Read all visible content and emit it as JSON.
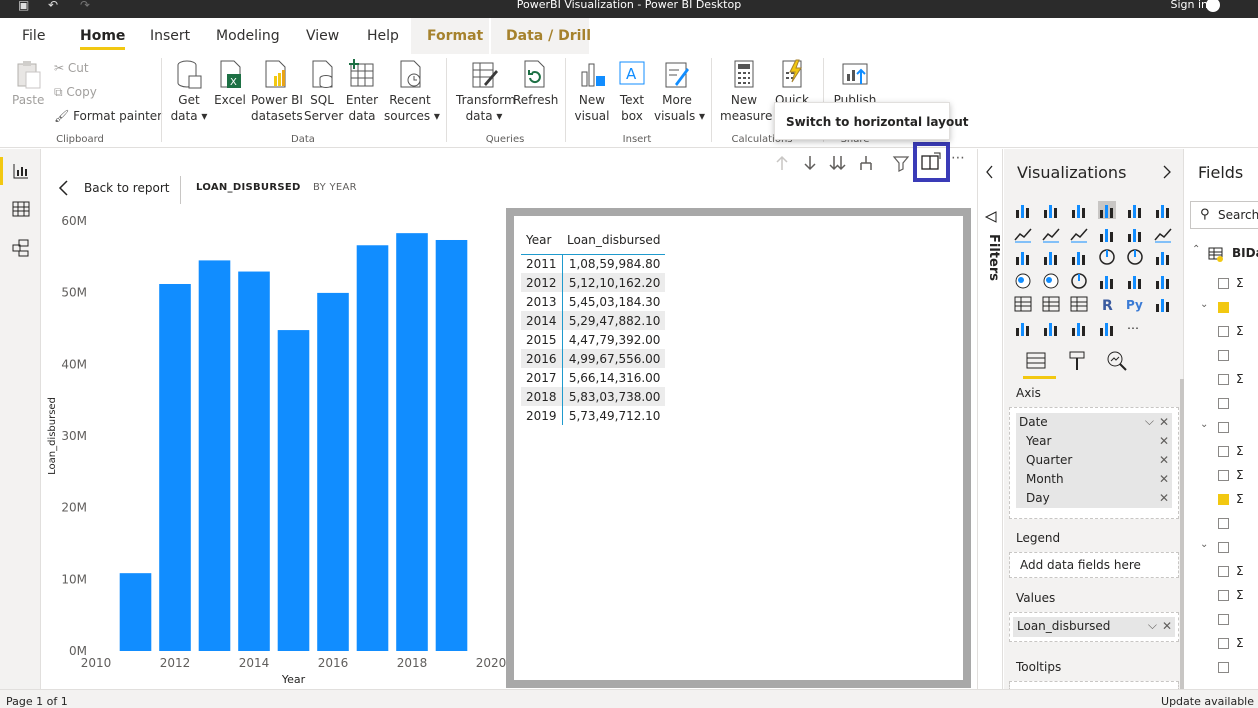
{
  "app": {
    "title": "PowerBI Visualization - Power BI Desktop",
    "signin": "Sign in"
  },
  "tabs": [
    "File",
    "Home",
    "Insert",
    "Modeling",
    "View",
    "Help",
    "Format",
    "Data / Drill"
  ],
  "ribbon": {
    "paste": "Paste",
    "cut": "Cut",
    "copy": "Copy",
    "format_painter": "Format painter",
    "get_data": [
      "Get",
      "data ▾"
    ],
    "excel": "Excel",
    "pbi_datasets": [
      "Power BI",
      "datasets"
    ],
    "sql": [
      "SQL",
      "Server"
    ],
    "enter_data": [
      "Enter",
      "data"
    ],
    "recent": [
      "Recent",
      "sources ▾"
    ],
    "transform": [
      "Transform",
      "data ▾"
    ],
    "refresh": "Refresh",
    "new_visual": [
      "New",
      "visual"
    ],
    "text_box": [
      "Text",
      "box"
    ],
    "more_visuals": [
      "More",
      "visuals ▾"
    ],
    "new_measure": [
      "New",
      "measure"
    ],
    "quick_measure": [
      "Quick",
      "m"
    ],
    "publish": "Publish",
    "groups": {
      "clipboard": "Clipboard",
      "data": "Data",
      "queries": "Queries",
      "insert": "Insert",
      "calculations": "Calculations",
      "share": "Share"
    }
  },
  "tooltip": "Switch to horizontal layout",
  "focus": {
    "back": "Back to report",
    "measure": "LOAN_DISBURSED",
    "by": "BY YEAR"
  },
  "chart_data": {
    "type": "bar",
    "categories": [
      "2011",
      "2012",
      "2013",
      "2014",
      "2015",
      "2016",
      "2017",
      "2018",
      "2019"
    ],
    "x": [
      2011,
      2012,
      2013,
      2014,
      2015,
      2016,
      2017,
      2018,
      2019
    ],
    "values": [
      10859984.8,
      51210162.2,
      54503184.3,
      52947882.1,
      44779392.0,
      49967556.0,
      56614316.0,
      58303738.0,
      57349712.1
    ],
    "xlabel": "Year",
    "ylabel": "Loan_disbursed",
    "xlim": [
      2010,
      2020
    ],
    "ylim": [
      0,
      60000000
    ],
    "xticks": [
      "2010",
      "2012",
      "2014",
      "2016",
      "2018",
      "2020"
    ],
    "yticks": [
      "0M",
      "10M",
      "20M",
      "30M",
      "40M",
      "50M",
      "60M"
    ],
    "color": "#118dff",
    "grid": false
  },
  "table": {
    "headers": [
      "Year",
      "Loan_disbursed"
    ],
    "rows": [
      [
        "2011",
        "1,08,59,984.80"
      ],
      [
        "2012",
        "5,12,10,162.20"
      ],
      [
        "2013",
        "5,45,03,184.30"
      ],
      [
        "2014",
        "5,29,47,882.10"
      ],
      [
        "2015",
        "4,47,79,392.00"
      ],
      [
        "2016",
        "4,99,67,556.00"
      ],
      [
        "2017",
        "5,66,14,316.00"
      ],
      [
        "2018",
        "5,83,03,738.00"
      ],
      [
        "2019",
        "5,73,49,712.10"
      ]
    ]
  },
  "filters": {
    "label": "Filters"
  },
  "viz": {
    "title": "Visualizations",
    "axis_label": "Axis",
    "axis_field": "Date",
    "axis_items": [
      "Year",
      "Quarter",
      "Month",
      "Day"
    ],
    "legend_label": "Legend",
    "legend_placeholder": "Add data fields here",
    "values_label": "Values",
    "values_field": "Loan_disbursed",
    "tooltips_label": "Tooltips"
  },
  "fields": {
    "title": "Fields",
    "search_placeholder": "Search",
    "table_name": "BIDa"
  },
  "status": {
    "page": "Page 1 of 1",
    "update": "Update available"
  },
  "colors": {
    "accent": "#f2c811",
    "bar": "#118dff",
    "highlight": "#3a3bb7"
  }
}
